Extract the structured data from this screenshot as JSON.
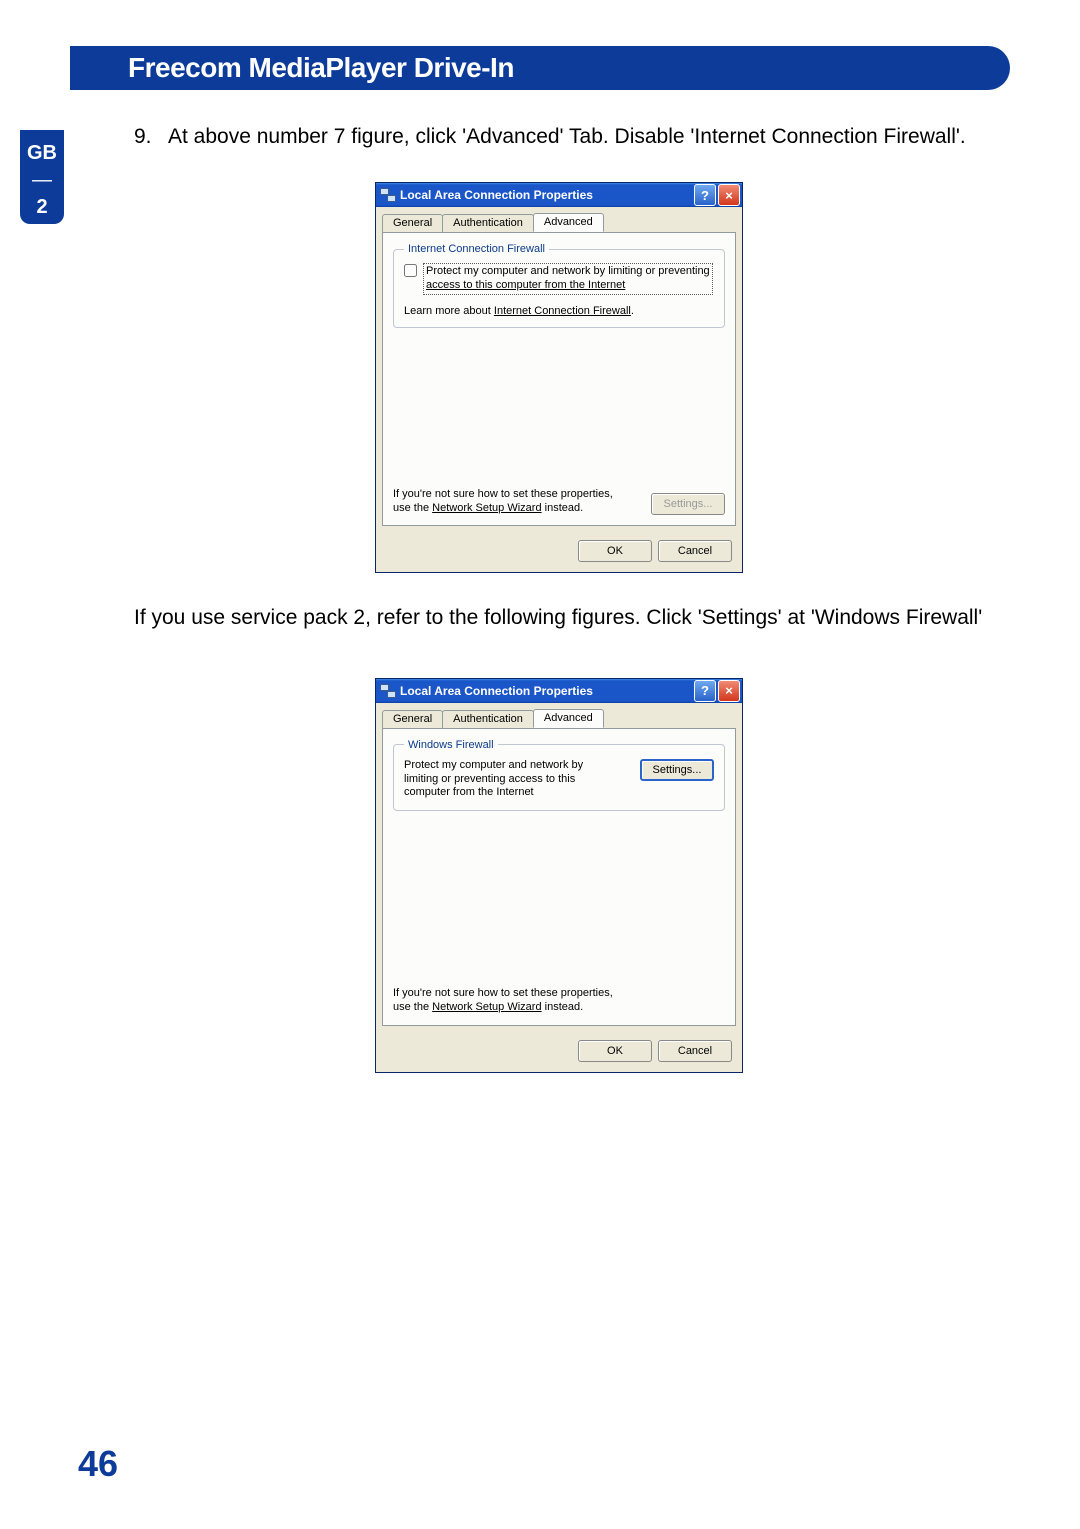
{
  "header": {
    "title": "Freecom MediaPlayer Drive-In"
  },
  "side_tab": {
    "lang": "GB",
    "chapter": "2"
  },
  "body": {
    "step_num": "9.",
    "step_text": "At above number 7 figure, click 'Advanced' Tab. Disable 'Internet Connection Firewall'.",
    "sp2_text": "If you use service pack 2, refer to the following figures. Click 'Settings' at 'Windows Firewall'"
  },
  "dialog1": {
    "title": "Local Area Connection Properties",
    "tabs": {
      "general": "General",
      "auth": "Authentication",
      "advanced": "Advanced"
    },
    "group_title": "Internet Connection Firewall",
    "checkbox_line1": "Protect my computer and network by limiting or preventing",
    "checkbox_line2": "access to this computer from the Internet",
    "learn_prefix": "Learn more about ",
    "learn_link": "Internet Connection Firewall",
    "learn_suffix": ".",
    "note1": "If you're not sure how to set these properties, use the ",
    "note_link": "Network Setup Wizard",
    "note2": " instead.",
    "settings_btn": "Settings...",
    "ok": "OK",
    "cancel": "Cancel"
  },
  "dialog2": {
    "title": "Local Area Connection Properties",
    "tabs": {
      "general": "General",
      "auth": "Authentication",
      "advanced": "Advanced"
    },
    "group_title": "Windows Firewall",
    "wf_text": "Protect my computer and network by limiting or preventing access to this computer from the Internet",
    "settings_btn": "Settings...",
    "note1": "If you're not sure how to set these properties, use the ",
    "note_link": "Network Setup Wizard",
    "note2": " instead.",
    "ok": "OK",
    "cancel": "Cancel"
  },
  "page_number": "46"
}
